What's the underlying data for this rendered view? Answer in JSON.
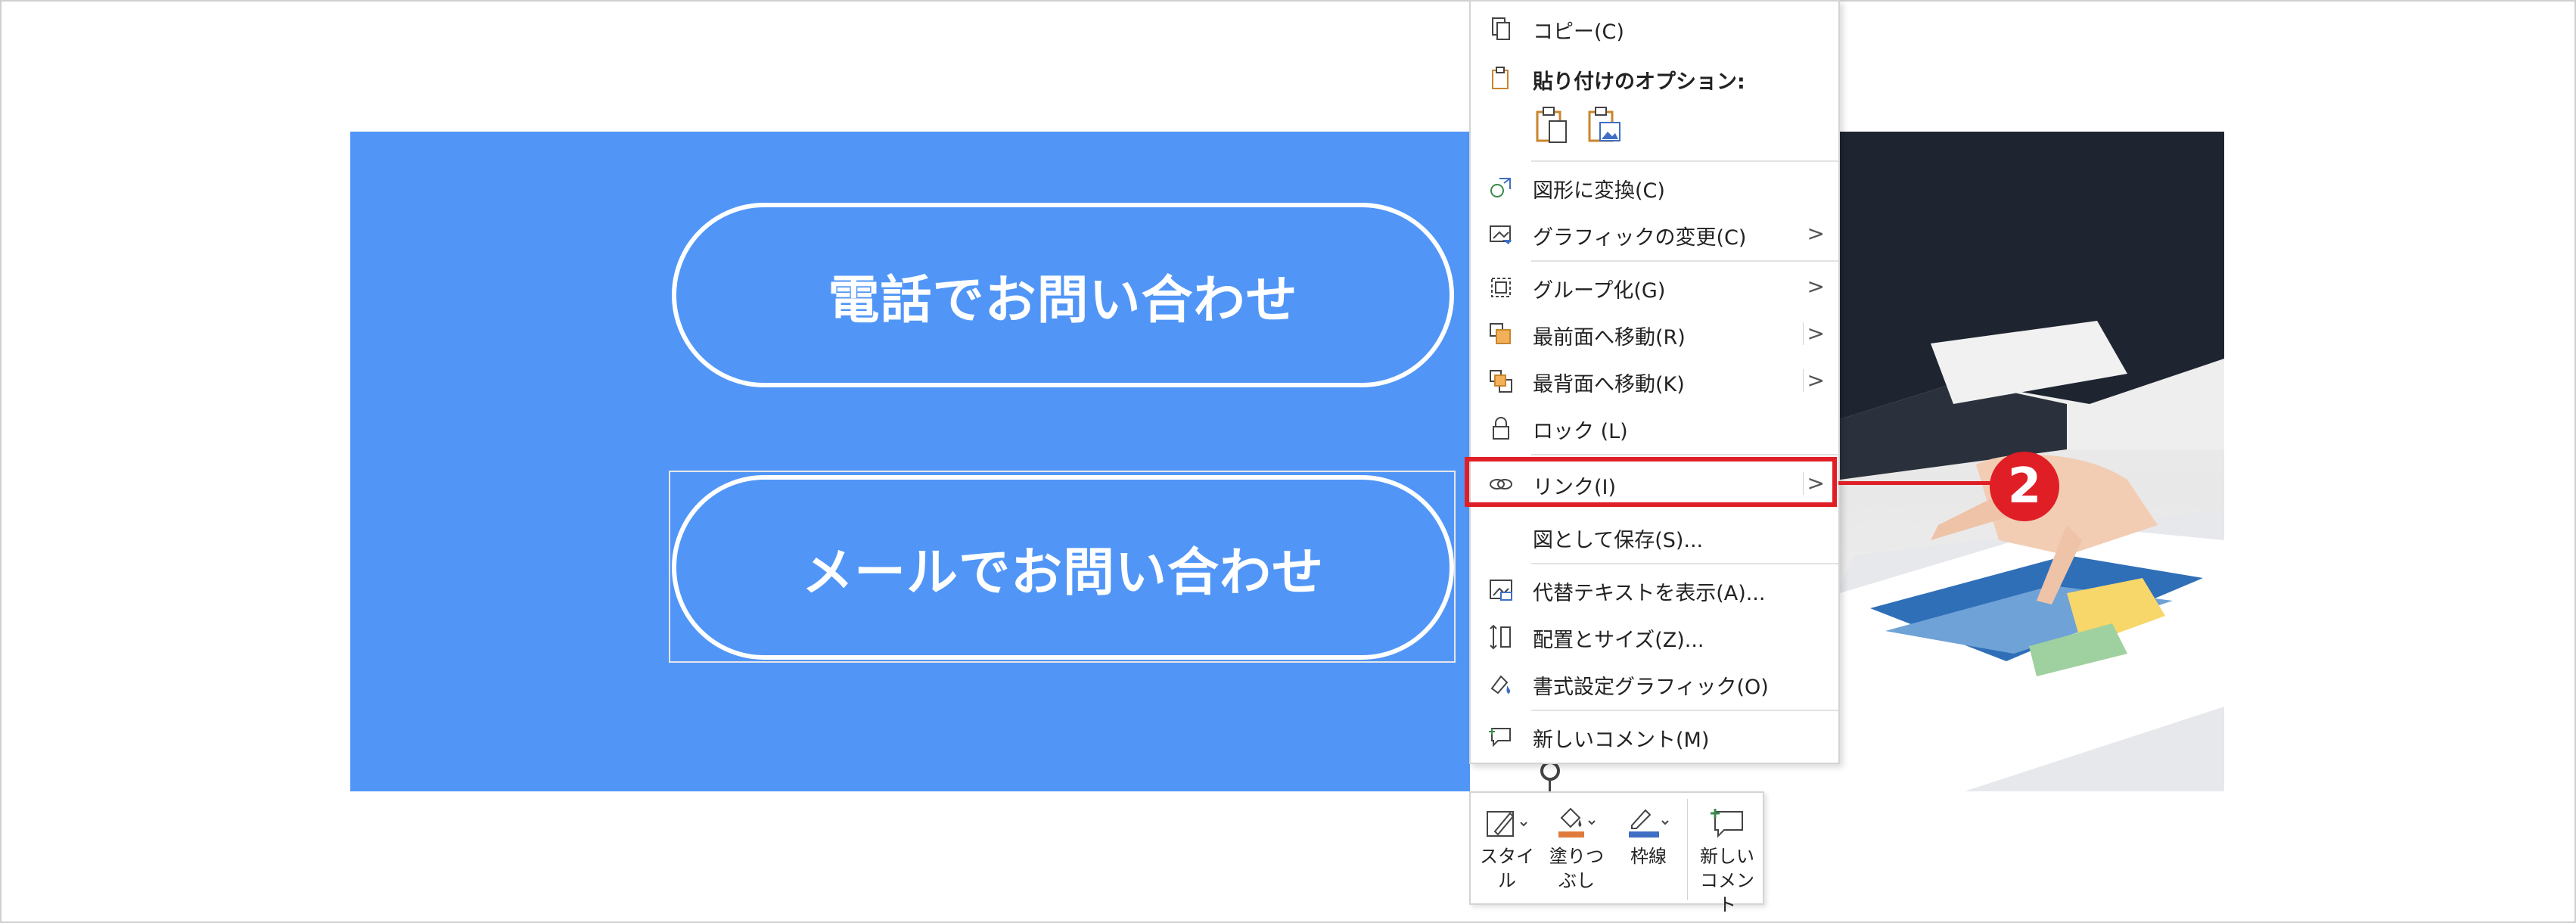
{
  "slide": {
    "buttons": [
      {
        "label": "電話でお問い合わせ"
      },
      {
        "label": "メールでお問い合わせ"
      }
    ]
  },
  "context_menu": {
    "items": [
      {
        "label": "コピー(C)",
        "icon": "copy-icon"
      },
      {
        "label": "貼り付けのオプション:",
        "icon": "paste-icon"
      },
      {
        "label": "図形に変換(C)",
        "icon": "convert-shape-icon"
      },
      {
        "label": "グラフィックの変更(C)",
        "icon": "change-graphic-icon",
        "submenu": ">"
      },
      {
        "label": "グループ化(G)",
        "icon": "group-icon",
        "submenu": ">"
      },
      {
        "label": "最前面へ移動(R)",
        "icon": "bring-front-icon",
        "submenu": ">"
      },
      {
        "label": "最背面へ移動(K)",
        "icon": "send-back-icon",
        "submenu": ">"
      },
      {
        "label": "ロック (L)",
        "icon": "lock-icon"
      },
      {
        "label": "リンク(I)",
        "icon": "link-icon",
        "submenu": ">"
      },
      {
        "label": "図として保存(S)...",
        "icon": ""
      },
      {
        "label": "代替テキストを表示(A)...",
        "icon": "alt-text-icon"
      },
      {
        "label": "配置とサイズ(Z)...",
        "icon": "size-position-icon"
      },
      {
        "label": "書式設定グラフィック(O)",
        "icon": "format-graphic-icon"
      },
      {
        "label": "新しいコメント(M)",
        "icon": "new-comment-icon"
      }
    ]
  },
  "callout": {
    "number": "2",
    "color": "#e01e26"
  },
  "mini_toolbar": {
    "style_label": "スタイル",
    "fill_label_1": "塗りつ",
    "fill_label_2": "ぶし",
    "outline_label": "枠線",
    "comment_label_1": "新しい",
    "comment_label_2": "コメント"
  },
  "colors": {
    "slide_blue": "#5196f7",
    "fill_accent": "#e07a3a",
    "outline_accent": "#3f6fc4",
    "highlight": "#e01e26"
  }
}
